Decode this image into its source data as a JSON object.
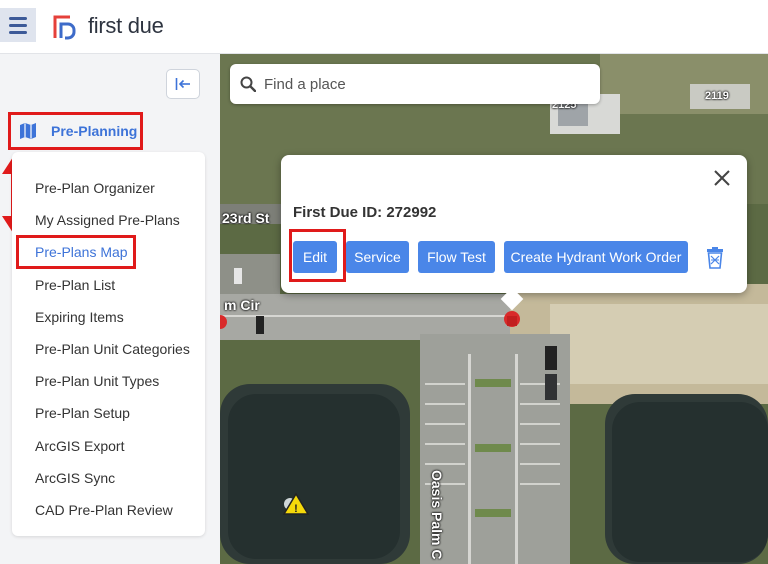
{
  "header": {
    "brand": "first due",
    "menu_icon": "hamburger-icon",
    "logo_icon": "first-due-logo-icon"
  },
  "sidebar": {
    "collapse_icon": "collapse-left-icon",
    "section": {
      "label": "Pre-Planning",
      "icon": "map-icon"
    },
    "items": [
      {
        "label": "Pre-Plan Organizer"
      },
      {
        "label": "My Assigned Pre-Plans"
      },
      {
        "label": "Pre-Plans Map",
        "active": true
      },
      {
        "label": "Pre-Plan List"
      },
      {
        "label": "Expiring Items"
      },
      {
        "label": "Pre-Plan Unit Categories"
      },
      {
        "label": "Pre-Plan Unit Types"
      },
      {
        "label": "Pre-Plan Setup"
      },
      {
        "label": "ArcGIS Export"
      },
      {
        "label": "ArcGIS Sync"
      },
      {
        "label": "CAD Pre-Plan Review"
      }
    ]
  },
  "map": {
    "search": {
      "placeholder": "Find a place",
      "icon": "search-icon"
    },
    "labels": {
      "street_23rd": "23rd St",
      "street_cir": "m Cir",
      "street_oasis": "Oasis Palm C",
      "addr_2125": "2125",
      "addr_2119": "2119"
    }
  },
  "popup": {
    "title": "First Due ID: 272992",
    "buttons": {
      "edit": "Edit",
      "service": "Service",
      "flow_test": "Flow Test",
      "work_order": "Create Hydrant Work Order"
    },
    "close_icon": "close-icon",
    "trash_icon": "trash-icon"
  },
  "colors": {
    "accent": "#4a86e8",
    "highlight": "#e01a1a",
    "active_text": "#3d73d8"
  }
}
